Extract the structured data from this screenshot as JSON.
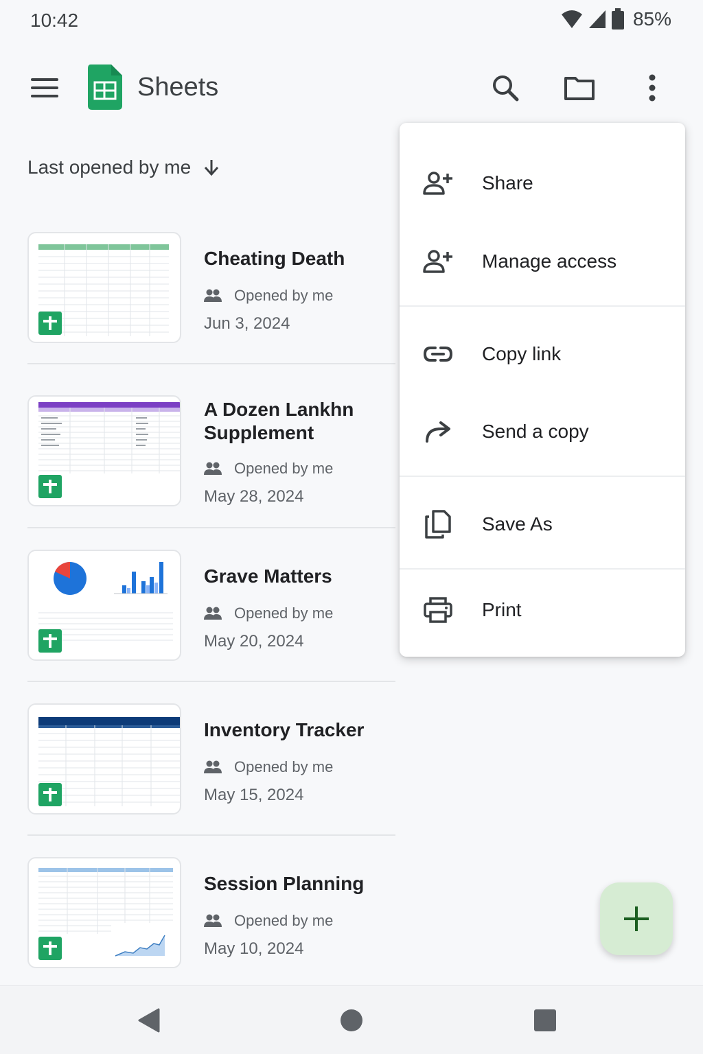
{
  "status": {
    "time": "10:42",
    "battery": "85%"
  },
  "app": {
    "title": "Sheets"
  },
  "sort": {
    "label": "Last opened by me"
  },
  "files": [
    {
      "title": "Cheating Death",
      "owner": "Opened by me",
      "date": "Jun 3, 2024",
      "thumb_header": "#4caf50"
    },
    {
      "title": "A Dozen Lankhn Supplement",
      "owner": "Opened by me",
      "date": "May 28, 2024",
      "thumb_header": "#7b3fc4"
    },
    {
      "title": "Grave Matters",
      "owner": "Opened by me",
      "date": "May 20, 2024",
      "thumb_header": "#1e73d9"
    },
    {
      "title": "Inventory Tracker",
      "owner": "Opened by me",
      "date": "May 15, 2024",
      "thumb_header": "#0d3b78"
    },
    {
      "title": "Session Planning",
      "owner": "Opened by me",
      "date": "May 10, 2024",
      "thumb_header": "#3f7fc2"
    }
  ],
  "menu": {
    "items": [
      {
        "label": "Share",
        "icon": "person-add-icon"
      },
      {
        "label": "Manage access",
        "icon": "person-add-icon"
      },
      {
        "label": "Copy link",
        "icon": "link-icon"
      },
      {
        "label": "Send a copy",
        "icon": "forward-icon"
      },
      {
        "label": "Save As",
        "icon": "copy-icon"
      },
      {
        "label": "Print",
        "icon": "print-icon"
      }
    ]
  },
  "colors": {
    "sheets_green": "#1fa463",
    "fab_bg": "#d6ecd3",
    "fab_icon": "#1b5e20"
  }
}
